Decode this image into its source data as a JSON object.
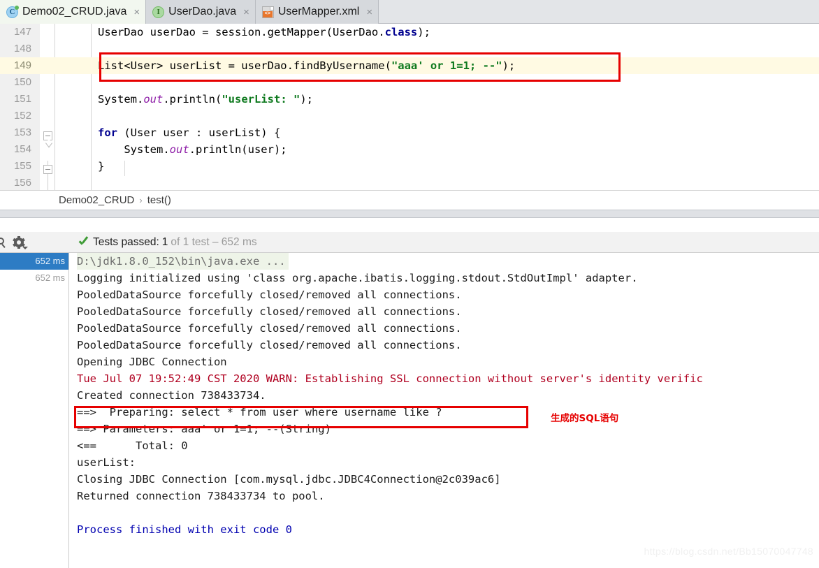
{
  "window": {
    "tabs": [
      {
        "label": "Demo02_CRUD.java",
        "icon": "java-class-icon",
        "active": true,
        "close": "×"
      },
      {
        "label": "UserDao.java",
        "icon": "java-interface-icon",
        "active": false,
        "close": "×"
      },
      {
        "label": "UserMapper.xml",
        "icon": "xml-file-icon",
        "active": false,
        "close": "×"
      }
    ]
  },
  "editor": {
    "highlighted_line": 149,
    "lines": [
      {
        "num": "147",
        "tokens": [
          {
            "t": "UserDao userDao = session.getMapper(UserDao.",
            "c": "plain"
          },
          {
            "t": "class",
            "c": "kw"
          },
          {
            "t": ");",
            "c": "plain"
          }
        ]
      },
      {
        "num": "148",
        "tokens": []
      },
      {
        "num": "149",
        "tokens": [
          {
            "t": "List<User> userList = userDao.findByUsername(",
            "c": "plain"
          },
          {
            "t": "\"aaa' or 1=1; --\"",
            "c": "str"
          },
          {
            "t": ");",
            "c": "plain"
          }
        ]
      },
      {
        "num": "150",
        "tokens": []
      },
      {
        "num": "151",
        "tokens": [
          {
            "t": "System.",
            "c": "plain"
          },
          {
            "t": "out",
            "c": "fld"
          },
          {
            "t": ".println(",
            "c": "plain"
          },
          {
            "t": "\"userList: \"",
            "c": "str"
          },
          {
            "t": ");",
            "c": "plain"
          }
        ]
      },
      {
        "num": "152",
        "tokens": []
      },
      {
        "num": "153",
        "tokens": [
          {
            "t": "for",
            "c": "kw"
          },
          {
            "t": " (User user : userList) {",
            "c": "plain"
          }
        ]
      },
      {
        "num": "154",
        "tokens": [
          {
            "t": "    System.",
            "c": "plain"
          },
          {
            "t": "out",
            "c": "fld"
          },
          {
            "t": ".println(user);",
            "c": "plain"
          }
        ]
      },
      {
        "num": "155",
        "tokens": [
          {
            "t": "}",
            "c": "plain"
          }
        ]
      },
      {
        "num": "156",
        "tokens": []
      }
    ]
  },
  "breadcrumb": {
    "items": [
      "Demo02_CRUD",
      "test()"
    ],
    "separator": "›"
  },
  "run_toolbar": {
    "status_prefix": "Tests passed:",
    "status_count": "1",
    "status_suffix": "of 1 test – 652 ms",
    "icons": [
      "search-icon",
      "settings-gear-icon"
    ]
  },
  "console": {
    "timestamps": [
      {
        "value": "652 ms",
        "selected": true
      },
      {
        "value": "652 ms",
        "selected": false
      }
    ],
    "lines": [
      {
        "text": "D:\\jdk1.8.0_152\\bin\\java.exe ...",
        "style": "cmd"
      },
      {
        "text": "Logging initialized using 'class org.apache.ibatis.logging.stdout.StdOutImpl' adapter.",
        "style": "normal"
      },
      {
        "text": "PooledDataSource forcefully closed/removed all connections.",
        "style": "normal"
      },
      {
        "text": "PooledDataSource forcefully closed/removed all connections.",
        "style": "normal"
      },
      {
        "text": "PooledDataSource forcefully closed/removed all connections.",
        "style": "normal"
      },
      {
        "text": "PooledDataSource forcefully closed/removed all connections.",
        "style": "normal"
      },
      {
        "text": "Opening JDBC Connection",
        "style": "normal"
      },
      {
        "text": "Tue Jul 07 19:52:49 CST 2020 WARN: Establishing SSL connection without server's identity verific",
        "style": "warn"
      },
      {
        "text": "Created connection 738433734.",
        "style": "normal"
      },
      {
        "text": "==>  Preparing: select * from user where username like ?",
        "style": "normal"
      },
      {
        "text": "==> Parameters: aaa' or 1=1; --(String)",
        "style": "normal"
      },
      {
        "text": "<==      Total: 0",
        "style": "normal"
      },
      {
        "text": "userList:",
        "style": "normal"
      },
      {
        "text": "Closing JDBC Connection [com.mysql.jdbc.JDBC4Connection@2c039ac6]",
        "style": "normal"
      },
      {
        "text": "Returned connection 738433734 to pool.",
        "style": "normal"
      },
      {
        "text": "",
        "style": "normal"
      },
      {
        "text": "Process finished with exit code 0",
        "style": "done"
      }
    ],
    "annotation": "生成的SQL语句",
    "watermark": "https://blog.csdn.net/Bb15070047748"
  },
  "colors": {
    "highlight_red": "#e60000",
    "line_highlight": "#fffae3",
    "selection_blue": "#2d7cc4",
    "pass_green": "#3d9b35"
  }
}
